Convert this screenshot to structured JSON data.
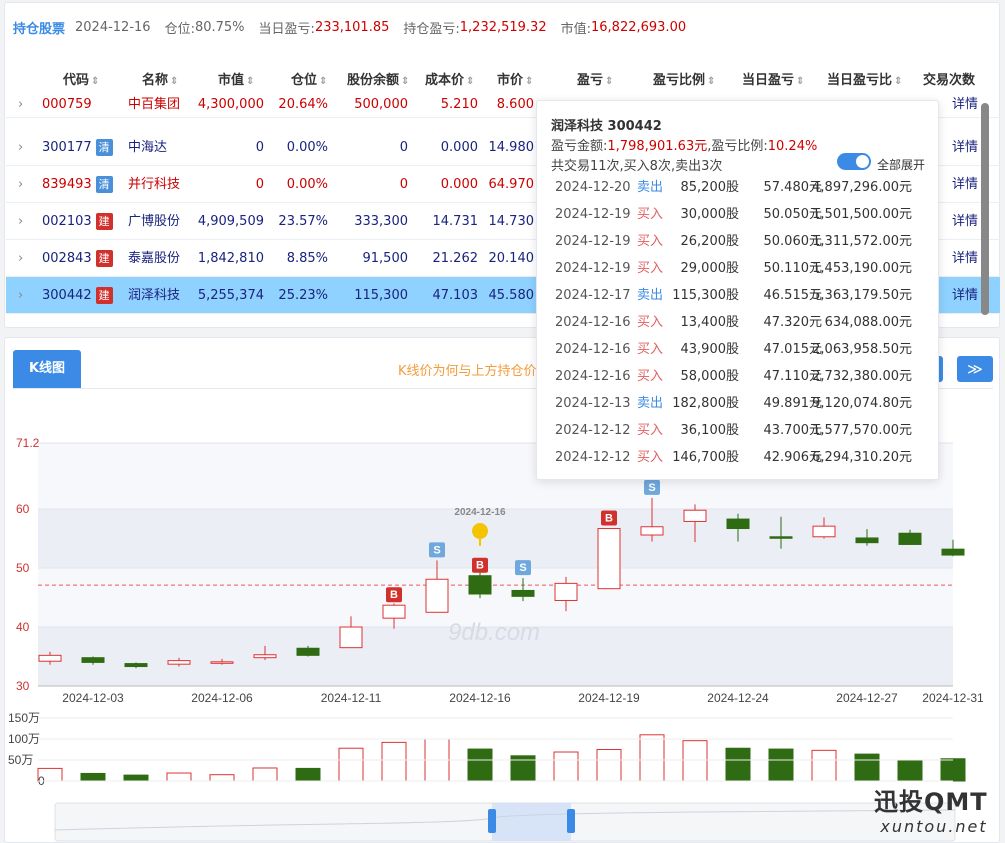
{
  "summary": {
    "title": "持仓股票",
    "date": "2024-12-16",
    "position_label": "仓位:",
    "position_value": "80.75%",
    "day_pnl_label": "当日盈亏:",
    "day_pnl_value": "233,101.85",
    "hold_pnl_label": "持仓盈亏:",
    "hold_pnl_value": "1,232,519.32",
    "mv_label": "市值:",
    "mv_value": "16,822,693.00"
  },
  "table": {
    "headers": [
      "代码",
      "名称",
      "市值",
      "仓位",
      "股份余额",
      "成本价",
      "市价",
      "盈亏",
      "盈亏比例",
      "当日盈亏",
      "当日盈亏比",
      "交易次数"
    ],
    "detail_label": "详情",
    "rows": [
      {
        "code": "000759",
        "name": "中百集团",
        "badge": "",
        "mv": "4,300,000",
        "pos": "20.64%",
        "shares": "500,000",
        "cost": "5.210",
        "price": "8.600",
        "color": "#c00"
      },
      {
        "code": "300177",
        "name": "中海达",
        "badge": "清",
        "mv": "0",
        "pos": "0.00%",
        "shares": "0",
        "cost": "0.000",
        "price": "14.980",
        "color": "#1a237e"
      },
      {
        "code": "839493",
        "name": "并行科技",
        "badge": "清",
        "mv": "0",
        "pos": "0.00%",
        "shares": "0",
        "cost": "0.000",
        "price": "64.970",
        "color": "#c00"
      },
      {
        "code": "002103",
        "name": "广博股份",
        "badge": "建",
        "mv": "4,909,509",
        "pos": "23.57%",
        "shares": "333,300",
        "cost": "14.731",
        "price": "14.730",
        "color": "#1a237e"
      },
      {
        "code": "002843",
        "name": "泰嘉股份",
        "badge": "建",
        "mv": "1,842,810",
        "pos": "8.85%",
        "shares": "91,500",
        "cost": "21.262",
        "price": "20.140",
        "color": "#1a237e"
      },
      {
        "code": "300442",
        "name": "润泽科技",
        "badge": "建",
        "mv": "5,255,374",
        "pos": "25.23%",
        "shares": "115,300",
        "cost": "47.103",
        "price": "45.580",
        "color": "#1a237e"
      }
    ]
  },
  "popup": {
    "title": "润泽科技 300442",
    "pnl_label": "盈亏金额:",
    "pnl_value": "1,798,901.63元",
    "ratio_label": ",盈亏比例:",
    "ratio_value": "10.24%",
    "count_text": "共交易11次,买入8次,卖出3次",
    "toggle_label": "全部展开",
    "trades": [
      {
        "date": "2024-12-20",
        "side": "卖出",
        "qty": "85,200股",
        "price": "57.480元",
        "amount": "4,897,296.00元"
      },
      {
        "date": "2024-12-19",
        "side": "买入",
        "qty": "30,000股",
        "price": "50.050元",
        "amount": "1,501,500.00元"
      },
      {
        "date": "2024-12-19",
        "side": "买入",
        "qty": "26,200股",
        "price": "50.060元",
        "amount": "1,311,572.00元"
      },
      {
        "date": "2024-12-19",
        "side": "买入",
        "qty": "29,000股",
        "price": "50.110元",
        "amount": "1,453,190.00元"
      },
      {
        "date": "2024-12-17",
        "side": "卖出",
        "qty": "115,300股",
        "price": "46.515元",
        "amount": "5,363,179.50元"
      },
      {
        "date": "2024-12-16",
        "side": "买入",
        "qty": "13,400股",
        "price": "47.320元",
        "amount": "634,088.00元"
      },
      {
        "date": "2024-12-16",
        "side": "买入",
        "qty": "43,900股",
        "price": "47.015元",
        "amount": "2,063,958.50元"
      },
      {
        "date": "2024-12-16",
        "side": "买入",
        "qty": "58,000股",
        "price": "47.110元",
        "amount": "2,732,380.00元"
      },
      {
        "date": "2024-12-13",
        "side": "卖出",
        "qty": "182,800股",
        "price": "49.891元",
        "amount": "9,120,074.80元"
      },
      {
        "date": "2024-12-12",
        "side": "买入",
        "qty": "36,100股",
        "price": "43.700元",
        "amount": "1,577,570.00元"
      },
      {
        "date": "2024-12-12",
        "side": "买入",
        "qty": "146,700股",
        "price": "42.906元",
        "amount": "6,294,310.20元"
      }
    ]
  },
  "kline": {
    "tab_label": "K线图",
    "notice": "K线价为何与上方持仓价",
    "next_label": "≫",
    "marker_label": "2024-12-16",
    "watermark_site": "9db.com",
    "watermark_brand": "迅投QMT",
    "watermark_url": "xuntou.net"
  },
  "chart_data": {
    "type": "candlestick",
    "y_ticks": [
      "71.2",
      "60",
      "50",
      "40",
      "30"
    ],
    "ylim": [
      30,
      71.2
    ],
    "vol_ticks": [
      "150万",
      "100万",
      "50万",
      "0"
    ],
    "x_ticks": [
      "2024-12-03",
      "2024-12-06",
      "2024-12-11",
      "2024-12-16",
      "2024-12-19",
      "2024-12-24",
      "2024-12-27",
      "2024-12-31"
    ],
    "cost_line": 47.1,
    "candles": [
      {
        "o": 34.2,
        "c": 35.2,
        "h": 35.8,
        "l": 33.6,
        "v": 300000,
        "flag": ""
      },
      {
        "o": 34.8,
        "c": 34.0,
        "h": 35.0,
        "l": 33.6,
        "v": 180000,
        "flag": ""
      },
      {
        "o": 33.8,
        "c": 33.3,
        "h": 34.0,
        "l": 33.0,
        "v": 140000,
        "flag": ""
      },
      {
        "o": 33.7,
        "c": 34.3,
        "h": 34.8,
        "l": 33.3,
        "v": 190000,
        "flag": ""
      },
      {
        "o": 33.9,
        "c": 34.1,
        "h": 34.6,
        "l": 33.6,
        "v": 150000,
        "flag": ""
      },
      {
        "o": 34.8,
        "c": 35.3,
        "h": 36.8,
        "l": 34.4,
        "v": 310000,
        "flag": ""
      },
      {
        "o": 36.4,
        "c": 35.2,
        "h": 36.8,
        "l": 35.0,
        "v": 300000,
        "flag": ""
      },
      {
        "o": 36.5,
        "c": 40.0,
        "h": 41.8,
        "l": 36.5,
        "v": 780000,
        "flag": ""
      },
      {
        "o": 41.5,
        "c": 43.7,
        "h": 44.0,
        "l": 39.7,
        "v": 920000,
        "flag": "B"
      },
      {
        "o": 42.5,
        "c": 48.1,
        "h": 51.3,
        "l": 42.5,
        "v": 1000000,
        "flag": "S"
      },
      {
        "o": 48.7,
        "c": 45.6,
        "h": 50.0,
        "l": 44.9,
        "v": 760000,
        "flag": "B"
      },
      {
        "o": 46.2,
        "c": 45.2,
        "h": 48.3,
        "l": 44.4,
        "v": 600000,
        "flag": "S"
      },
      {
        "o": 44.5,
        "c": 47.4,
        "h": 48.5,
        "l": 42.7,
        "v": 690000,
        "flag": ""
      },
      {
        "o": 46.5,
        "c": 56.7,
        "h": 56.7,
        "l": 46.5,
        "v": 750000,
        "flag": "B"
      },
      {
        "o": 55.6,
        "c": 57.0,
        "h": 61.9,
        "l": 54.5,
        "v": 1100000,
        "flag": "S"
      },
      {
        "o": 57.9,
        "c": 59.8,
        "h": 60.8,
        "l": 54.4,
        "v": 960000,
        "flag": ""
      },
      {
        "o": 58.3,
        "c": 56.7,
        "h": 59.2,
        "l": 54.5,
        "v": 780000,
        "flag": ""
      },
      {
        "o": 55.3,
        "c": 55.2,
        "h": 58.7,
        "l": 53.3,
        "v": 760000,
        "flag": ""
      },
      {
        "o": 55.3,
        "c": 57.1,
        "h": 58.6,
        "l": 55.0,
        "v": 730000,
        "flag": ""
      },
      {
        "o": 55.1,
        "c": 54.3,
        "h": 56.6,
        "l": 53.8,
        "v": 640000,
        "flag": ""
      },
      {
        "o": 55.9,
        "c": 54.0,
        "h": 56.5,
        "l": 53.9,
        "v": 480000,
        "flag": ""
      },
      {
        "o": 53.2,
        "c": 52.2,
        "h": 54.8,
        "l": 52.0,
        "v": 530000,
        "flag": ""
      }
    ]
  },
  "colors": {
    "up": "#d33",
    "down": "#2e6b12",
    "accent": "#3b8be6",
    "selected": "#8fd1ff"
  }
}
